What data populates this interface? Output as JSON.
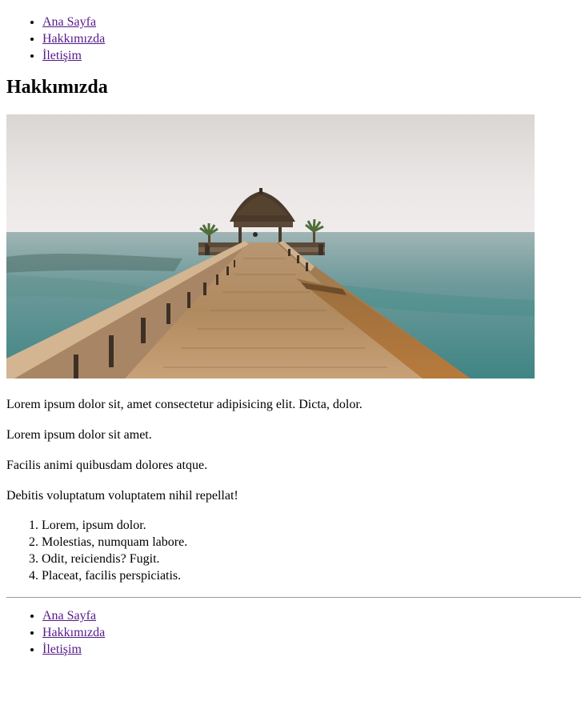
{
  "nav_top": {
    "items": [
      {
        "label": "Ana Sayfa"
      },
      {
        "label": "Hakkımızda"
      },
      {
        "label": "İletişim"
      }
    ]
  },
  "page_title": "Hakkımızda",
  "image": {
    "icon": "beach-pier-photo"
  },
  "paragraphs": [
    "Lorem ipsum dolor sit, amet consectetur adipisicing elit. Dicta, dolor.",
    "Lorem ipsum dolor sit amet.",
    "Facilis animi quibusdam dolores atque.",
    "Debitis voluptatum voluptatem nihil repellat!"
  ],
  "ordered_list": [
    "Lorem, ipsum dolor.",
    "Molestias, numquam labore.",
    "Odit, reiciendis? Fugit.",
    "Placeat, facilis perspiciatis."
  ],
  "nav_bottom": {
    "items": [
      {
        "label": "Ana Sayfa"
      },
      {
        "label": "Hakkımızda"
      },
      {
        "label": "İletişim"
      }
    ]
  },
  "colors": {
    "link_visited": "#551a8b",
    "divider": "#9a9a9a"
  }
}
